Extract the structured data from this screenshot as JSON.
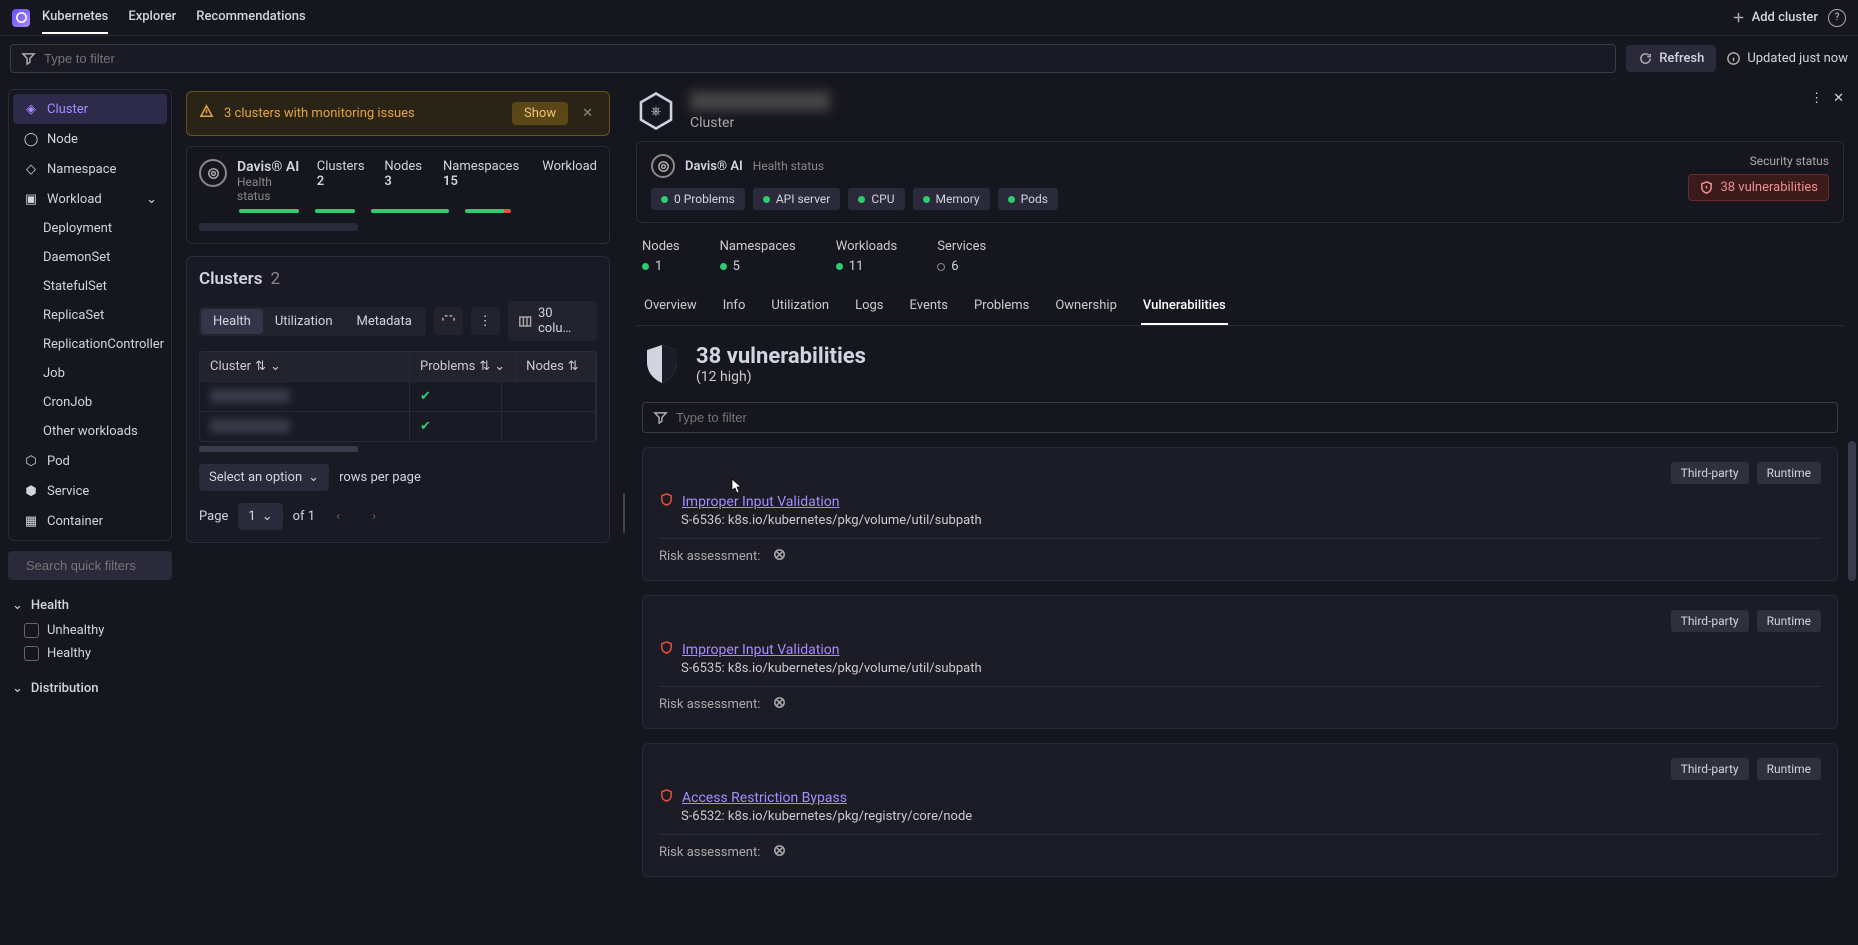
{
  "topnav": {
    "tabs": [
      "Kubernetes",
      "Explorer",
      "Recommendations"
    ],
    "active_index": 0,
    "add_cluster": "Add cluster"
  },
  "filterbar": {
    "placeholder": "Type to filter",
    "refresh": "Refresh",
    "updated": "Updated just now"
  },
  "sidebar": {
    "primary": [
      {
        "label": "Cluster",
        "icon": "cluster-icon",
        "active": true
      },
      {
        "label": "Node",
        "icon": "node-icon"
      },
      {
        "label": "Namespace",
        "icon": "namespace-icon"
      },
      {
        "label": "Workload",
        "icon": "workload-icon",
        "expandable": true
      }
    ],
    "workload_children": [
      "Deployment",
      "DaemonSet",
      "StatefulSet",
      "ReplicaSet",
      "ReplicationController",
      "Job",
      "CronJob",
      "Other workloads"
    ],
    "secondary": [
      {
        "label": "Pod",
        "icon": "pod-icon"
      },
      {
        "label": "Service",
        "icon": "service-icon"
      },
      {
        "label": "Container",
        "icon": "container-icon"
      }
    ],
    "search_placeholder": "Search quick filters",
    "groups": {
      "health": {
        "label": "Health",
        "items": [
          "Unhealthy",
          "Healthy"
        ]
      },
      "distribution": {
        "label": "Distribution"
      }
    }
  },
  "alert": {
    "text": "3 clusters with monitoring issues",
    "show": "Show"
  },
  "davis": {
    "title": "Davis® AI",
    "subtitle": "Health status",
    "stats": [
      {
        "label": "Clusters",
        "value": "2"
      },
      {
        "label": "Nodes",
        "value": "3"
      },
      {
        "label": "Namespaces",
        "value": "15"
      },
      {
        "label": "Workload",
        "value": ""
      }
    ]
  },
  "clusters": {
    "title": "Clusters",
    "count": "2",
    "view_tabs": [
      "Health",
      "Utilization",
      "Metadata"
    ],
    "columns_btn": "30 colu…",
    "headers": [
      "Cluster",
      "Problems",
      "Nodes"
    ],
    "rows_label": "rows per page",
    "select_opt": "Select an option",
    "page_label": "Page",
    "page_current": "1",
    "page_of": "of 1"
  },
  "detail": {
    "type_label": "Cluster",
    "davis_title": "Davis® AI",
    "davis_sub": "Health status",
    "pills": [
      "0 Problems",
      "API server",
      "CPU",
      "Memory",
      "Pods"
    ],
    "security_label": "Security status",
    "vuln_badge": "38 vulnerabilities",
    "metrics": [
      {
        "label": "Nodes",
        "value": "1",
        "filled": true
      },
      {
        "label": "Namespaces",
        "value": "5",
        "filled": true
      },
      {
        "label": "Workloads",
        "value": "11",
        "filled": true
      },
      {
        "label": "Services",
        "value": "6",
        "filled": false
      }
    ],
    "tabs": [
      "Overview",
      "Info",
      "Utilization",
      "Logs",
      "Events",
      "Problems",
      "Ownership",
      "Vulnerabilities"
    ],
    "active_tab": "Vulnerabilities",
    "vuln_title": "38 vulnerabilities",
    "vuln_sub": "(12 high)",
    "vuln_filter_placeholder": "Type to filter",
    "vulns": [
      {
        "name": "Improper Input Validation",
        "id": "S-6536: k8s.io/kubernetes/pkg/volume/util/subpath",
        "badges": [
          "Third-party",
          "Runtime"
        ],
        "risk": "Risk assessment:"
      },
      {
        "name": "Improper Input Validation",
        "id": "S-6535: k8s.io/kubernetes/pkg/volume/util/subpath",
        "badges": [
          "Third-party",
          "Runtime"
        ],
        "risk": "Risk assessment:"
      },
      {
        "name": "Access Restriction Bypass",
        "id": "S-6532: k8s.io/kubernetes/pkg/registry/core/node",
        "badges": [
          "Third-party",
          "Runtime"
        ],
        "risk": "Risk assessment:"
      }
    ]
  }
}
